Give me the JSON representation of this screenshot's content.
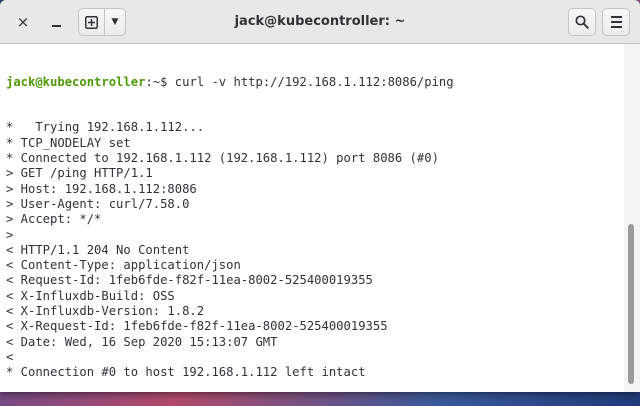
{
  "window": {
    "title": "jack@kubecontroller: ~",
    "close_icon": "×",
    "newtab_icon": "⊞",
    "menu_arrow_icon": "▼",
    "search_icon": "🔍"
  },
  "terminal": {
    "prompt_user": "jack@kubecontroller",
    "prompt_path": ":~$ ",
    "command": "curl -v http://192.168.1.112:8086/ping",
    "output": [
      "*   Trying 192.168.1.112...",
      "* TCP_NODELAY set",
      "* Connected to 192.168.1.112 (192.168.1.112) port 8086 (#0)",
      "> GET /ping HTTP/1.1",
      "> Host: 192.168.1.112:8086",
      "> User-Agent: curl/7.58.0",
      "> Accept: */*",
      ">",
      "< HTTP/1.1 204 No Content",
      "< Content-Type: application/json",
      "< Request-Id: 1feb6fde-f82f-11ea-8002-525400019355",
      "< X-Influxdb-Build: OSS",
      "< X-Influxdb-Version: 1.8.2",
      "< X-Request-Id: 1feb6fde-f82f-11ea-8002-525400019355",
      "< Date: Wed, 16 Sep 2020 15:13:07 GMT",
      "<",
      "* Connection #0 to host 192.168.1.112 left intact"
    ]
  },
  "colors": {
    "prompt_user": "#4e9a06",
    "text": "#2e3436",
    "background": "#ffffff"
  }
}
